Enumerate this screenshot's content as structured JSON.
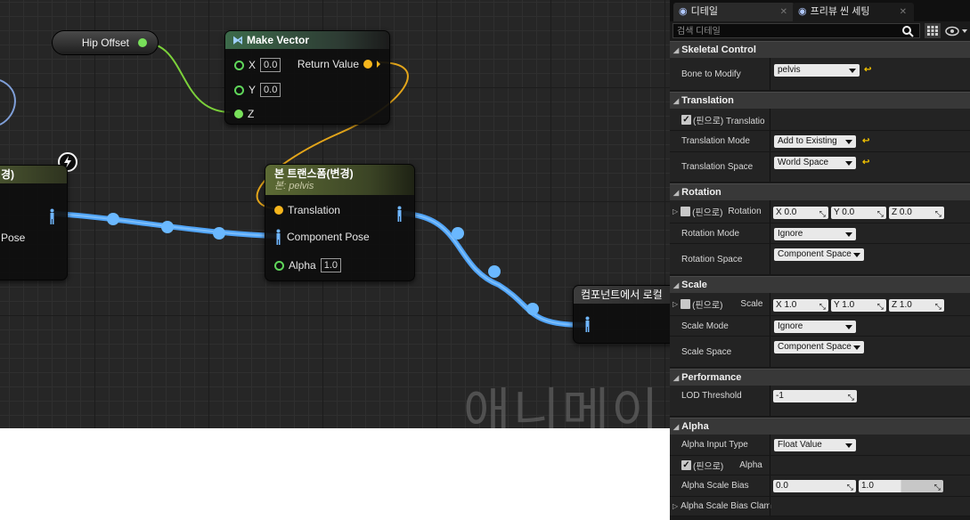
{
  "graph": {
    "hip_offset_label": "Hip Offset",
    "make_vector": {
      "title": "Make Vector",
      "x_label": "X",
      "x_value": "0.0",
      "y_label": "Y",
      "y_value": "0.0",
      "z_label": "Z",
      "return_label": "Return Value"
    },
    "left_node": {
      "title": "경)",
      "pose_label": "Pose"
    },
    "bone_node": {
      "title": "본 트랜스폼(변경)",
      "subtitle": "본: pelvis",
      "translation_label": "Translation",
      "component_pose_label": "Component Pose",
      "alpha_label": "Alpha",
      "alpha_value": "1.0"
    },
    "local_node": {
      "title": "컴포넌트에서 로컬"
    },
    "watermark": "애니메이"
  },
  "panel": {
    "tabs": [
      {
        "label": "디테일"
      },
      {
        "label": "프리뷰 씬 세팅"
      }
    ],
    "search_placeholder": "검색 디테일",
    "categories": {
      "skeletal": "Skeletal Control",
      "translation": "Translation",
      "rotation": "Rotation",
      "scale": "Scale",
      "performance": "Performance",
      "alpha": "Alpha"
    },
    "rows": {
      "bone_to_modify": {
        "label": "Bone to Modify",
        "value": "pelvis"
      },
      "translation_pin": {
        "label": "(핀으로) Translatio"
      },
      "translation_mode": {
        "label": "Translation Mode",
        "value": "Add to Existing"
      },
      "translation_space": {
        "label": "Translation Space",
        "value": "World Space"
      },
      "rotation_pin": {
        "pin_label": "(핀으로)",
        "label": "Rotation",
        "x": "X  0.0",
        "y": "Y  0.0",
        "z": "Z  0.0"
      },
      "rotation_mode": {
        "label": "Rotation Mode",
        "value": "Ignore"
      },
      "rotation_space": {
        "label": "Rotation Space",
        "value": "Component Space"
      },
      "scale_pin": {
        "pin_label": "(핀으로)",
        "label": "Scale",
        "x": "X  1.0",
        "y": "Y  1.0",
        "z": "Z  1.0"
      },
      "scale_mode": {
        "label": "Scale Mode",
        "value": "Ignore"
      },
      "scale_space": {
        "label": "Scale Space",
        "value": "Component Space"
      },
      "lod_threshold": {
        "label": "LOD Threshold",
        "value": "-1"
      },
      "alpha_input_type": {
        "label": "Alpha Input Type",
        "value": "Float Value"
      },
      "alpha_pin": {
        "pin_label": "(핀으로)",
        "label": "Alpha"
      },
      "alpha_scale_bias": {
        "label": "Alpha Scale Bias",
        "min": "0.0",
        "max": "1.0"
      },
      "alpha_scale_bias_clamp": {
        "label": "Alpha Scale Bias Clam"
      }
    },
    "colors": {
      "reset_arrow": "#f2c200",
      "exec_wire": "#5ab0ff",
      "vector_wire": "#f5b51c",
      "float_wire": "#7bd13a"
    }
  }
}
